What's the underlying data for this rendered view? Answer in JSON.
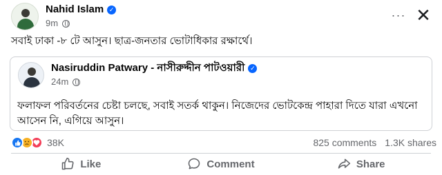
{
  "post": {
    "author": "Nahid Islam",
    "time": "9m",
    "more_label": "···",
    "close_label": "✕",
    "text": "সবাই ঢাকা -৮ টে আসুন। ছাত্র-জনতার ভোটাধিকার রক্ষার্থে।"
  },
  "shared": {
    "author": "Nasiruddin Patwary - নাসীরুদ্দীন পাটওয়ারী",
    "time": "24m",
    "text": "ফলাফল পরিবর্তনের চেষ্টা চলছে, সবাই সতর্ক থাকুন। নিজেদের ভোটকেন্দ্র পাহারা দিতে যারা এখনো আসেন নি, এগিয়ে আসুন।"
  },
  "stats": {
    "reactions_count": "38K",
    "comments": "825 comments",
    "shares": "1.3K shares"
  },
  "actions": {
    "like": "Like",
    "comment": "Comment",
    "share": "Share"
  },
  "colors": {
    "brand_blue": "#0866ff",
    "secondary_text": "#65676b",
    "divider": "#ced0d4",
    "love_red": "#f33e58",
    "sad_yellow": "#f7b125"
  },
  "icons": [
    "verified-badge-icon",
    "globe-icon",
    "like-reaction-icon",
    "sad-reaction-icon",
    "love-reaction-icon",
    "like-thumb-icon",
    "comment-bubble-icon",
    "share-arrow-icon"
  ]
}
